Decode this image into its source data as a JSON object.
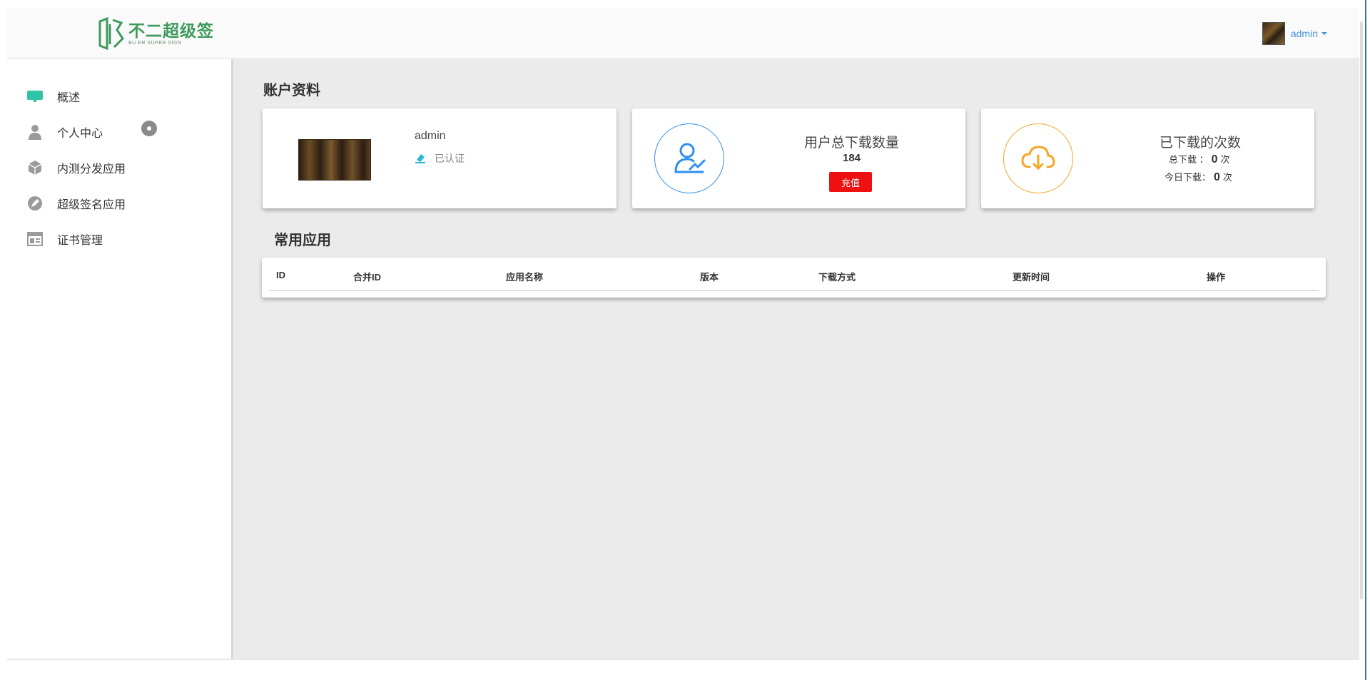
{
  "brand": {
    "name": "不二超级签",
    "subtitle": "BU ER SUPER SIGN",
    "color": "#3f9a5c"
  },
  "header": {
    "username": "admin"
  },
  "sidebar": {
    "items": [
      {
        "label": "概述",
        "icon": "monitor-icon",
        "color": "#2ec4a6"
      },
      {
        "label": "个人中心",
        "icon": "user-icon",
        "color": "#9a9a9a"
      },
      {
        "label": "内测分发应用",
        "icon": "package-icon",
        "color": "#9a9a9a"
      },
      {
        "label": "超级签名应用",
        "icon": "pen-icon",
        "color": "#9a9a9a"
      },
      {
        "label": "证书管理",
        "icon": "table-icon",
        "color": "#9a9a9a"
      }
    ]
  },
  "account": {
    "section_title": "账户资料",
    "profile": {
      "name": "admin",
      "cert_status": "已认证"
    },
    "downloads_card": {
      "title": "用户总下载数量",
      "count": "184",
      "recharge_label": "充值",
      "accent": "#2f8ff0"
    },
    "downloaded_card": {
      "title": "已下载的次数",
      "total_label": "总下载 ：",
      "total_value": "0",
      "total_unit": "次",
      "today_label": "今日下载：",
      "today_value": "0",
      "today_unit": "次",
      "accent": "#f5a623"
    }
  },
  "apps": {
    "section_title": "常用应用",
    "columns": [
      "ID",
      "合并ID",
      "应用名称",
      "版本",
      "下载方式",
      "更新时间",
      "操作"
    ]
  }
}
